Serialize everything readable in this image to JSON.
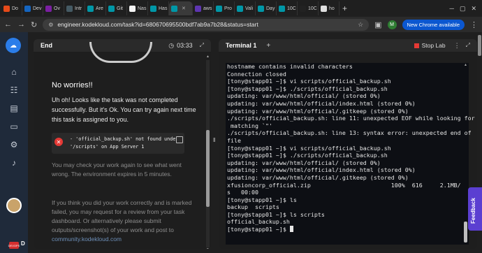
{
  "browser": {
    "tabs": [
      {
        "label": "Do",
        "color": "#e64a19"
      },
      {
        "label": "Dev",
        "color": "#1565c0"
      },
      {
        "label": "Ov",
        "color": "#7b1fa2"
      },
      {
        "label": "Intr",
        "color": "#455a64"
      },
      {
        "label": "Are",
        "color": "#0097a7"
      },
      {
        "label": "Git",
        "color": "#0097a7"
      },
      {
        "label": "Nas",
        "color": "#f5f5f5"
      },
      {
        "label": "Has",
        "color": "#0097a7"
      },
      {
        "label": "",
        "color": "#0097a7",
        "active": true
      },
      {
        "label": "aws",
        "color": "#5e35b1"
      },
      {
        "label": "Pro",
        "color": "#0097a7"
      },
      {
        "label": "Vali",
        "color": "#0097a7"
      },
      {
        "label": "Day",
        "color": "#0097a7"
      },
      {
        "label": "10C",
        "color": "#0097a7"
      },
      {
        "label": "10C",
        "color": "#222222"
      },
      {
        "label": "ho",
        "color": "#e0e0e0"
      }
    ],
    "url": "engineer.kodekloud.com/task?id=680670695500bdf7ab9a7b28&status=start",
    "profile_initial": "M",
    "update_button": "New Chrome available"
  },
  "left_panel": {
    "title": "End",
    "timer": "03:33",
    "heading": "No worries!!",
    "message": "Uh oh! Looks like the task was not completed successfully. But it's Ok. You can try again next time this task is assigned to you.",
    "error_lines": [
      "- 'official_backup.sh' not found unde",
      "'/scripts' on App Server 1"
    ],
    "check_text": "You may check your work again to see what went wrong. The environment expires in 5 minutes.",
    "review_text": "If you think you did your work correctly and is marked failed, you may request for a review from your task dashboard. Or alternatively please submit outputs/screenshot(s) of your work and post to",
    "community_link": "community.kodekloud.com"
  },
  "terminal": {
    "tab_label": "Terminal 1",
    "stop_label": "Stop Lab",
    "lines": [
      "hostname contains invalid characters",
      "Connection closed",
      "[tony@stapp01 ~]$ vi scripts/official_backup.sh",
      "[tony@stapp01 ~]$ ./scripts/official_backup.sh",
      "updating: var/www/html/official/ (stored 0%)",
      "updating: var/www/html/official/index.html (stored 0%)",
      "updating: var/www/html/official/.gitkeep (stored 0%)",
      "./scripts/official_backup.sh: line 11: unexpected EOF while looking for",
      " matching `\"'",
      "./scripts/official_backup.sh: line 13: syntax error: unexpected end of",
      "file",
      "[tony@stapp01 ~]$ vi scripts/official_backup.sh",
      "[tony@stapp01 ~]$ ./scripts/official_backup.sh",
      "updating: var/www/html/official/ (stored 0%)",
      "updating: var/www/html/official/index.html (stored 0%)",
      "updating: var/www/html/official/.gitkeep (stored 0%)",
      "xfusioncorp_official.zip                       100%  616     2.1MB/",
      "s   00:00",
      "[tony@stapp01 ~]$ ls",
      "backup  scripts",
      "[tony@stapp01 ~]$ ls scripts",
      "official_backup.sh"
    ],
    "prompt": "[tony@stapp01 ~]$ "
  },
  "sidebar": {
    "user_badge": "DEVOPS",
    "user_initial": "D"
  },
  "feedback_label": "Feedback"
}
